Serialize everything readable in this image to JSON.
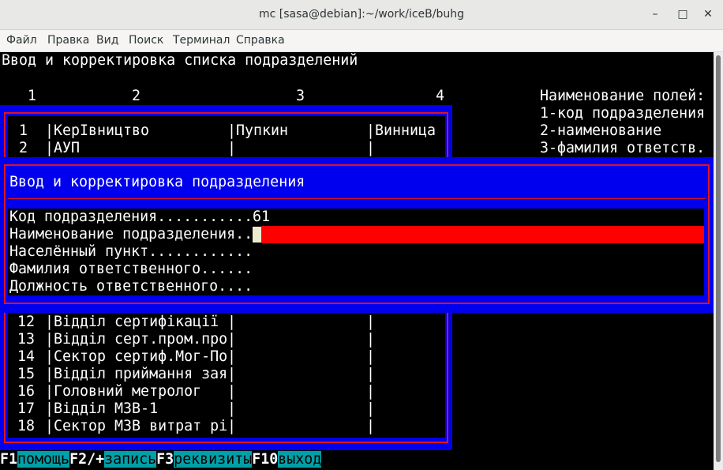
{
  "window": {
    "title": "mc [sasa@debian]:~/work/iceB/buhg"
  },
  "menu": [
    "Файл",
    "Правка",
    "Вид",
    "Поиск",
    "Терминал",
    "Справка"
  ],
  "screen": {
    "heading": "Ввод и корректировка списка подразделений",
    "columns": [
      "1",
      "2",
      "3",
      "4"
    ],
    "legend": [
      "Наименование полей:",
      "1-код подразделения",
      "2-наименование",
      "3-фамилия ответств."
    ]
  },
  "table": {
    "top_rows": [
      {
        "num": "1",
        "name": "КерІвництво",
        "person": "Пупкин",
        "city": "Винница"
      },
      {
        "num": "2",
        "name": "АУП",
        "person": "",
        "city": ""
      }
    ],
    "bottom_rows": [
      {
        "num": "12",
        "name": "Відділ сертифікації",
        "person": "",
        "city": ""
      },
      {
        "num": "13",
        "name": "Відділ серт.пром.про",
        "person": "",
        "city": ""
      },
      {
        "num": "14",
        "name": "Сектор сертиф.Мог-По",
        "person": "",
        "city": ""
      },
      {
        "num": "15",
        "name": "Відділ приймання зая",
        "person": "",
        "city": ""
      },
      {
        "num": "16",
        "name": "Головний метролог",
        "person": "",
        "city": ""
      },
      {
        "num": "17",
        "name": "Відділ МЗВ-1",
        "person": "",
        "city": ""
      },
      {
        "num": "18",
        "name": "Сектор МЗВ витрат рі",
        "person": "",
        "city": ""
      }
    ]
  },
  "dialog": {
    "title": "Ввод и корректировка подразделения",
    "fields": [
      {
        "label": "Код подразделения...........",
        "value": "61"
      },
      {
        "label": "Наименование подразделения..",
        "value": ""
      },
      {
        "label": "Населённый пункт............",
        "value": ""
      },
      {
        "label": "Фамилия ответственного......",
        "value": ""
      },
      {
        "label": "Должность ответственного....",
        "value": ""
      }
    ]
  },
  "keys": [
    {
      "key": "F1",
      "label": "помощь"
    },
    {
      "key": "F2/+",
      "label": "запись"
    },
    {
      "key": "F3",
      "label": "реквизиты"
    },
    {
      "key": "F10",
      "label": "выход"
    }
  ],
  "colors": {
    "frame_blue": "#0000ee",
    "frame_red": "#e0141b",
    "active_field": "#ff0000",
    "keybar_cyan": "#00a0a8"
  }
}
